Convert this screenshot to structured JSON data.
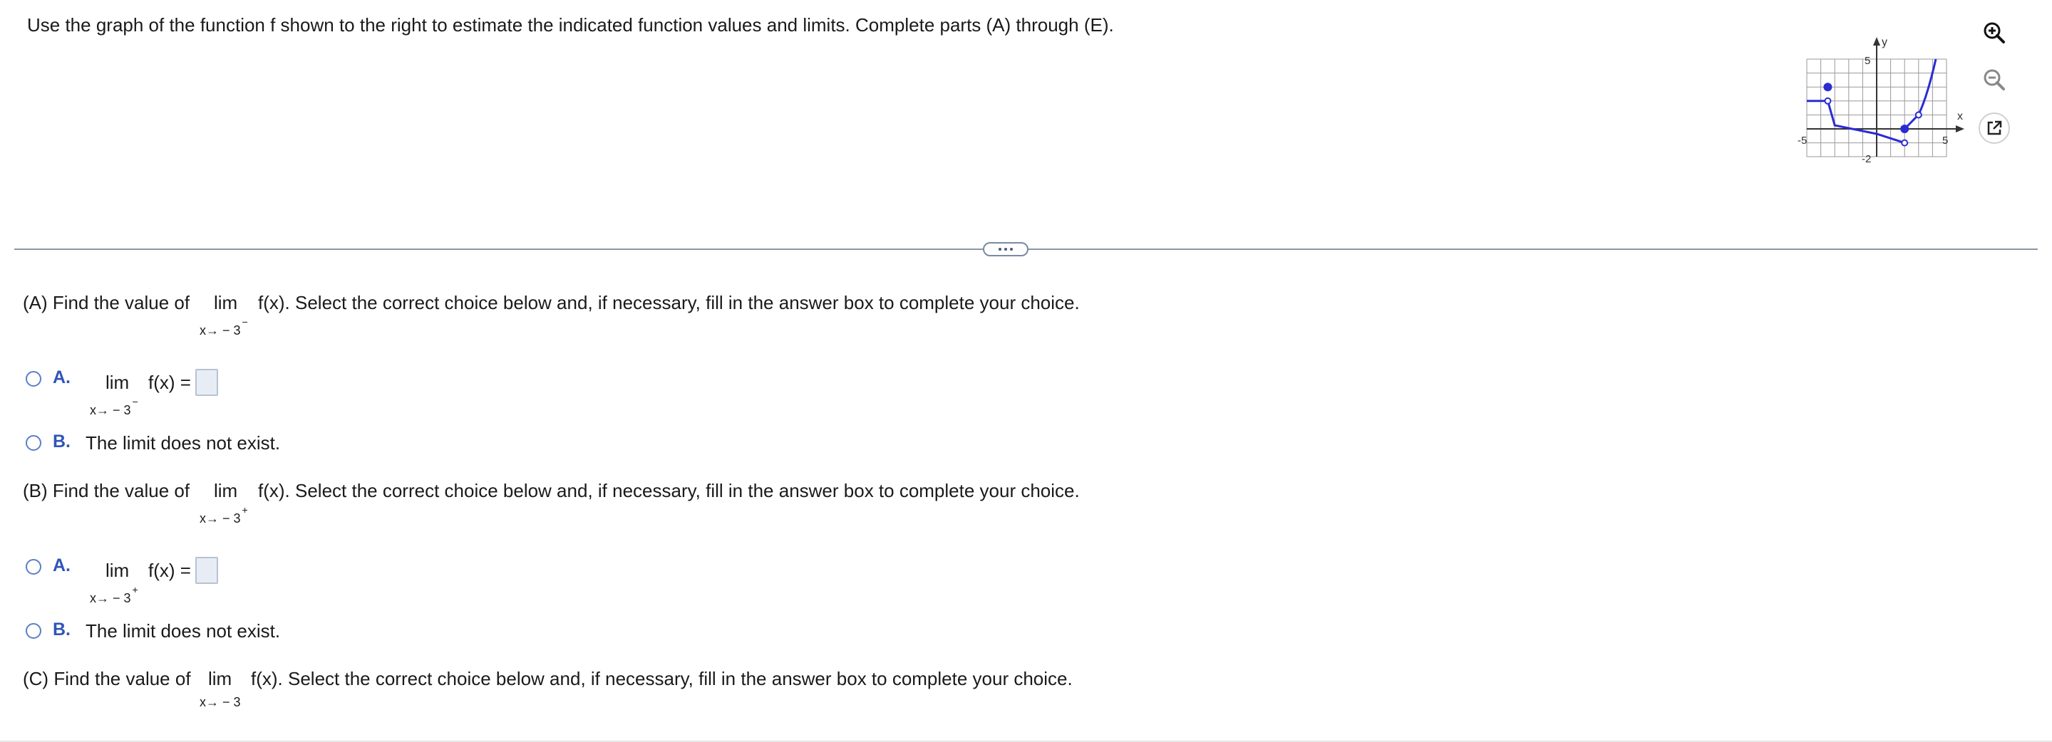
{
  "instructions": "Use the graph of the function f shown to the right to estimate the indicated function values and limits. Complete parts (A) through (E).",
  "graph": {
    "y_axis_label": "y",
    "x_axis_label": "x",
    "y_tick_top": "5",
    "y_tick_bottom": "-2",
    "x_tick_left": "-5",
    "x_tick_right": "5"
  },
  "toolbar": {
    "zoom_in": "zoom-in",
    "zoom_out": "zoom-out",
    "open_new": "open-external"
  },
  "partA": {
    "prompt_before": "(A) Find the value of",
    "lim": "lim",
    "sub": "x→ − 3",
    "sup": "−",
    "prompt_after": "f(x). Select the correct choice below and, if necessary, fill in the answer box to complete your choice.",
    "choiceA_letter": "A.",
    "choiceA_lim": "lim",
    "choiceA_expr": "f(x) =",
    "choiceA_sub": "x→ − 3",
    "choiceA_sup": "−",
    "choiceB_letter": "B.",
    "choiceB_text": "The limit does not exist."
  },
  "partB": {
    "prompt_before": "(B) Find the value of",
    "lim": "lim",
    "sub": "x→ − 3",
    "sup": "+",
    "prompt_after": "f(x). Select the correct choice below and, if necessary, fill in the answer box to complete your choice.",
    "choiceA_letter": "A.",
    "choiceA_lim": "lim",
    "choiceA_expr": "f(x) =",
    "choiceA_sub": "x→ − 3",
    "choiceA_sup": "+",
    "choiceB_letter": "B.",
    "choiceB_text": "The limit does not exist."
  },
  "partC": {
    "prompt_before": "(C) Find the value of",
    "lim": "lim",
    "sub": "x→ − 3",
    "prompt_after": "f(x). Select the correct choice below and, if necessary, fill in the answer box to complete your choice."
  }
}
